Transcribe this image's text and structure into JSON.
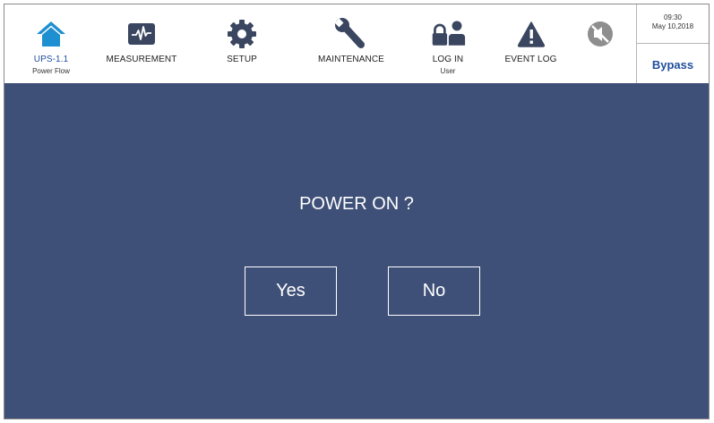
{
  "nav": {
    "items": [
      {
        "label": "UPS-1.1",
        "sublabel": "Power Flow",
        "icon": "home-icon",
        "active": true
      },
      {
        "label": "MEASUREMENT",
        "icon": "waveform-icon"
      },
      {
        "label": "SETUP",
        "icon": "gear-icon"
      },
      {
        "label": "MAINTENANCE",
        "icon": "wrench-icon"
      },
      {
        "label": "LOG IN",
        "sublabel": "User",
        "icon": "lock-user-icon"
      },
      {
        "label": "EVENT LOG",
        "icon": "warning-icon"
      },
      {
        "icon": "mute-icon"
      }
    ]
  },
  "status": {
    "time": "09:30",
    "date": "May 10,2018",
    "mode": "Bypass"
  },
  "dialog": {
    "title": "POWER ON ?",
    "yes_label": "Yes",
    "no_label": "No"
  },
  "colors": {
    "accent": "#1f4e9e",
    "home_icon": "#1e8fd0",
    "icon_dark": "#3a4660",
    "mute_icon": "#8e8e8e",
    "dialog_bg": "#3f5078"
  }
}
